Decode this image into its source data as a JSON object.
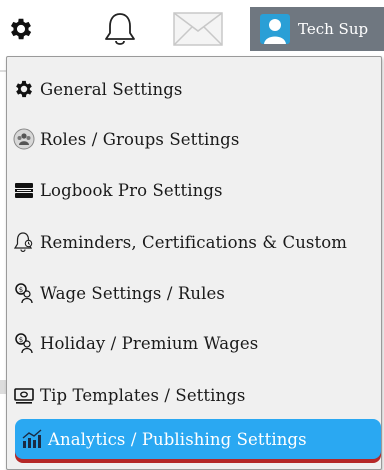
{
  "topbar": {
    "user_name": "Tech Sup"
  },
  "menu": {
    "items": [
      {
        "label": "General Settings",
        "icon": "gear-icon"
      },
      {
        "label": "Roles / Groups Settings",
        "icon": "roles-icon"
      },
      {
        "label": "Logbook Pro Settings",
        "icon": "logbook-icon"
      },
      {
        "label": "Reminders, Certifications & Custom",
        "icon": "reminder-bell-icon"
      },
      {
        "label": "Wage Settings / Rules",
        "icon": "wage-icon"
      },
      {
        "label": "Holiday / Premium Wages",
        "icon": "holiday-wage-icon"
      },
      {
        "label": "Tip Templates / Settings",
        "icon": "tip-icon"
      },
      {
        "label": "Analytics / Publishing Settings",
        "icon": "analytics-icon"
      }
    ],
    "active_index": 7
  },
  "colors": {
    "active_bg": "#2aa8f2",
    "active_underline": "#b52828",
    "menu_bg": "#f0f0f0",
    "user_chip_bg": "#6f7780",
    "avatar_bg": "#2a9fd6"
  }
}
